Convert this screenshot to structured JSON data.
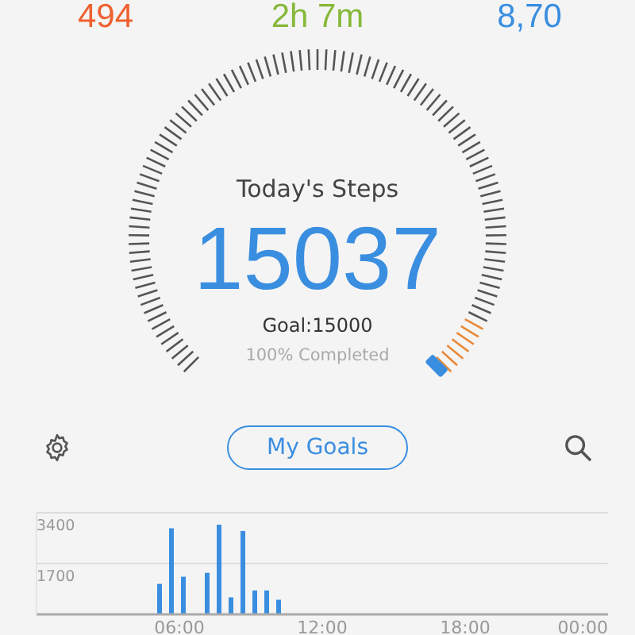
{
  "stats": [
    {
      "value": "494",
      "color": "#ef6130"
    },
    {
      "value": "2h 7m",
      "color": "#86b83a"
    },
    {
      "value": "8,70",
      "color": "#3a8ee0"
    }
  ],
  "steps": {
    "title": "Today's Steps",
    "count": "15037",
    "goal": "Goal:15000",
    "completed": "100% Completed"
  },
  "toolbar": {
    "goals_button": "My Goals"
  },
  "chart_data": {
    "type": "bar",
    "x": [
      5,
      5.5,
      6,
      7,
      7.5,
      8,
      8.5,
      9,
      9.5,
      10
    ],
    "values": [
      1020,
      2880,
      1260,
      1390,
      3000,
      570,
      2790,
      800,
      800,
      490
    ],
    "xlim": [
      0,
      24
    ],
    "ylim": [
      0,
      3400
    ],
    "yticks": [
      1700,
      3400
    ],
    "xticks": [
      {
        "value": 6,
        "label": "06:00"
      },
      {
        "value": 12,
        "label": "12:00"
      },
      {
        "value": 18,
        "label": "18:00"
      },
      {
        "value": 24,
        "label": "00:00"
      }
    ]
  }
}
